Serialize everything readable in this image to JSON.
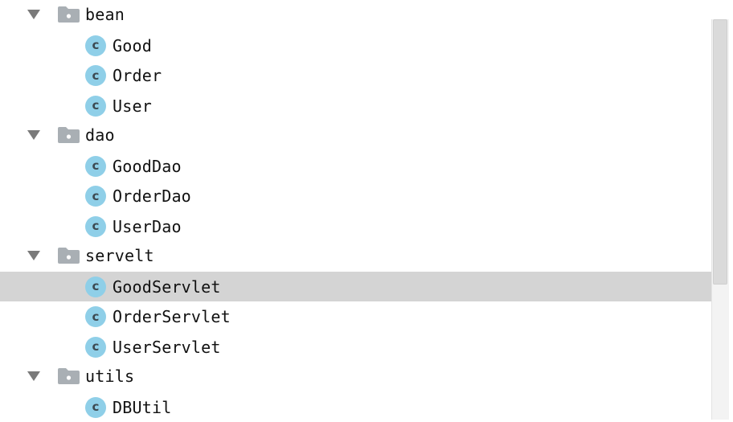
{
  "tree": {
    "packages": [
      {
        "name": "bean",
        "expanded": true,
        "classes": [
          "Good",
          "Order",
          "User"
        ]
      },
      {
        "name": "dao",
        "expanded": true,
        "classes": [
          "GoodDao",
          "OrderDao",
          "UserDao"
        ]
      },
      {
        "name": "servelt",
        "expanded": true,
        "classes": [
          "GoodServlet",
          "OrderServlet",
          "UserServlet"
        ]
      },
      {
        "name": "utils",
        "expanded": true,
        "classes": [
          "DBUtil"
        ]
      }
    ],
    "selected": "GoodServlet",
    "class_icon_letter": "c",
    "icons": {
      "expand": "triangle-down-icon",
      "package": "folder-package-icon",
      "class": "class-c-icon"
    },
    "colors": {
      "selection": "#d4d4d4",
      "class_icon": "#8fcfe8",
      "folder": "#a9afb4"
    }
  }
}
